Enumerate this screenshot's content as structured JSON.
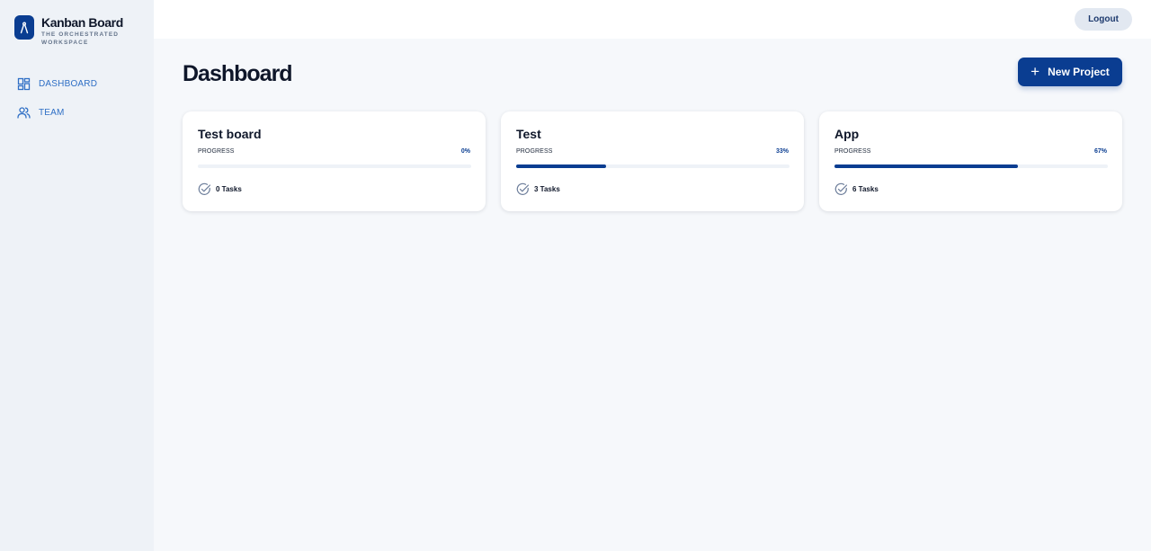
{
  "brand": {
    "title": "Kanban Board",
    "subtitle": "THE ORCHESTRATED WORKSPACE",
    "logo_icon": "compass-icon"
  },
  "sidebar": {
    "items": [
      {
        "label": "DASHBOARD",
        "icon": "dashboard-grid-icon"
      },
      {
        "label": "TEAM",
        "icon": "users-icon"
      }
    ]
  },
  "header": {
    "logout_label": "Logout"
  },
  "main": {
    "title": "Dashboard",
    "new_project_label": "New Project",
    "progress_label": "PROGRESS",
    "projects": [
      {
        "name": "Test board",
        "progress_text": "0%",
        "progress": 0,
        "tasks_text": "0 Tasks"
      },
      {
        "name": "Test",
        "progress_text": "33%",
        "progress": 0.33,
        "tasks_text": "3 Tasks"
      },
      {
        "name": "App",
        "progress_text": "67%",
        "progress": 0.67,
        "tasks_text": "6 Tasks"
      }
    ]
  },
  "colors": {
    "accent": "#0a3d91",
    "nav_text": "#2f6fc5",
    "sidebar_bg": "#eef2f7",
    "page_bg": "#f6f8fb"
  }
}
